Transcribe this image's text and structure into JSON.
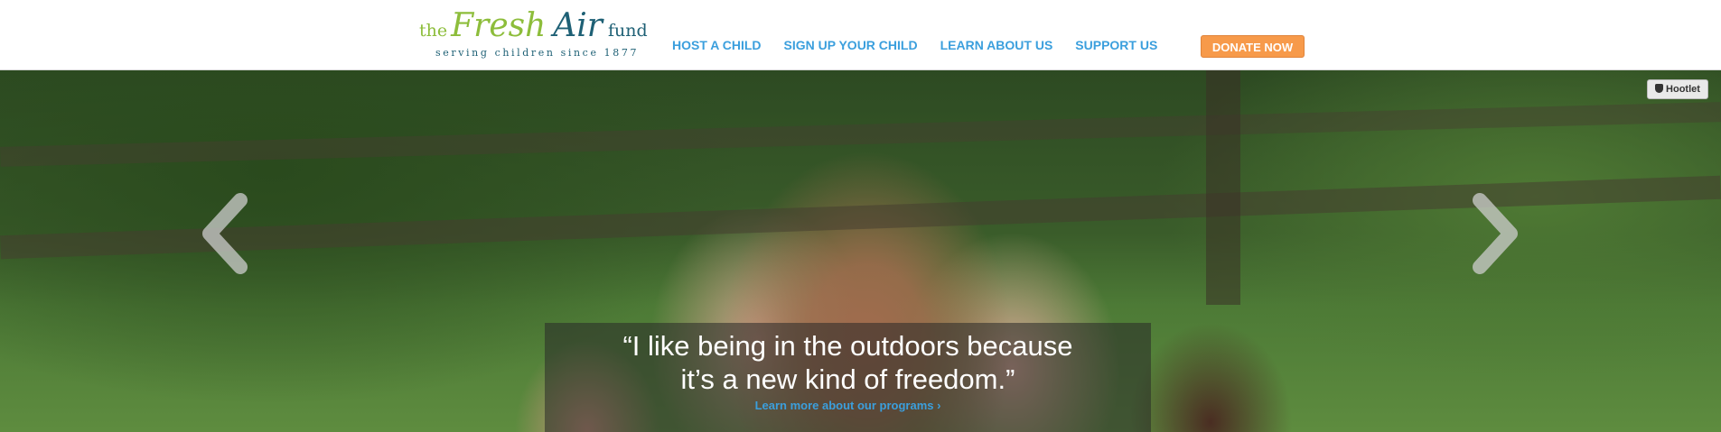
{
  "logo": {
    "the": "the",
    "fresh": "Fresh",
    "air": "Air",
    "fund": "fund",
    "tagline": "serving children since 1877"
  },
  "nav": {
    "items": [
      {
        "label": "HOST A CHILD"
      },
      {
        "label": "SIGN UP YOUR CHILD"
      },
      {
        "label": "LEARN ABOUT US"
      },
      {
        "label": "SUPPORT US"
      }
    ],
    "donate_label": "DONATE NOW"
  },
  "hero": {
    "quote_line1": "“I like being in the outdoors because",
    "quote_line2": "it’s a new kind of freedom.”",
    "link_label": "Learn more about our programs ›",
    "hootlet_label": "Hootlet"
  },
  "colors": {
    "brand_green": "#8dbd3b",
    "brand_teal": "#1e6075",
    "nav_blue": "#3b9fdd",
    "donate_orange": "#f79a4a"
  }
}
